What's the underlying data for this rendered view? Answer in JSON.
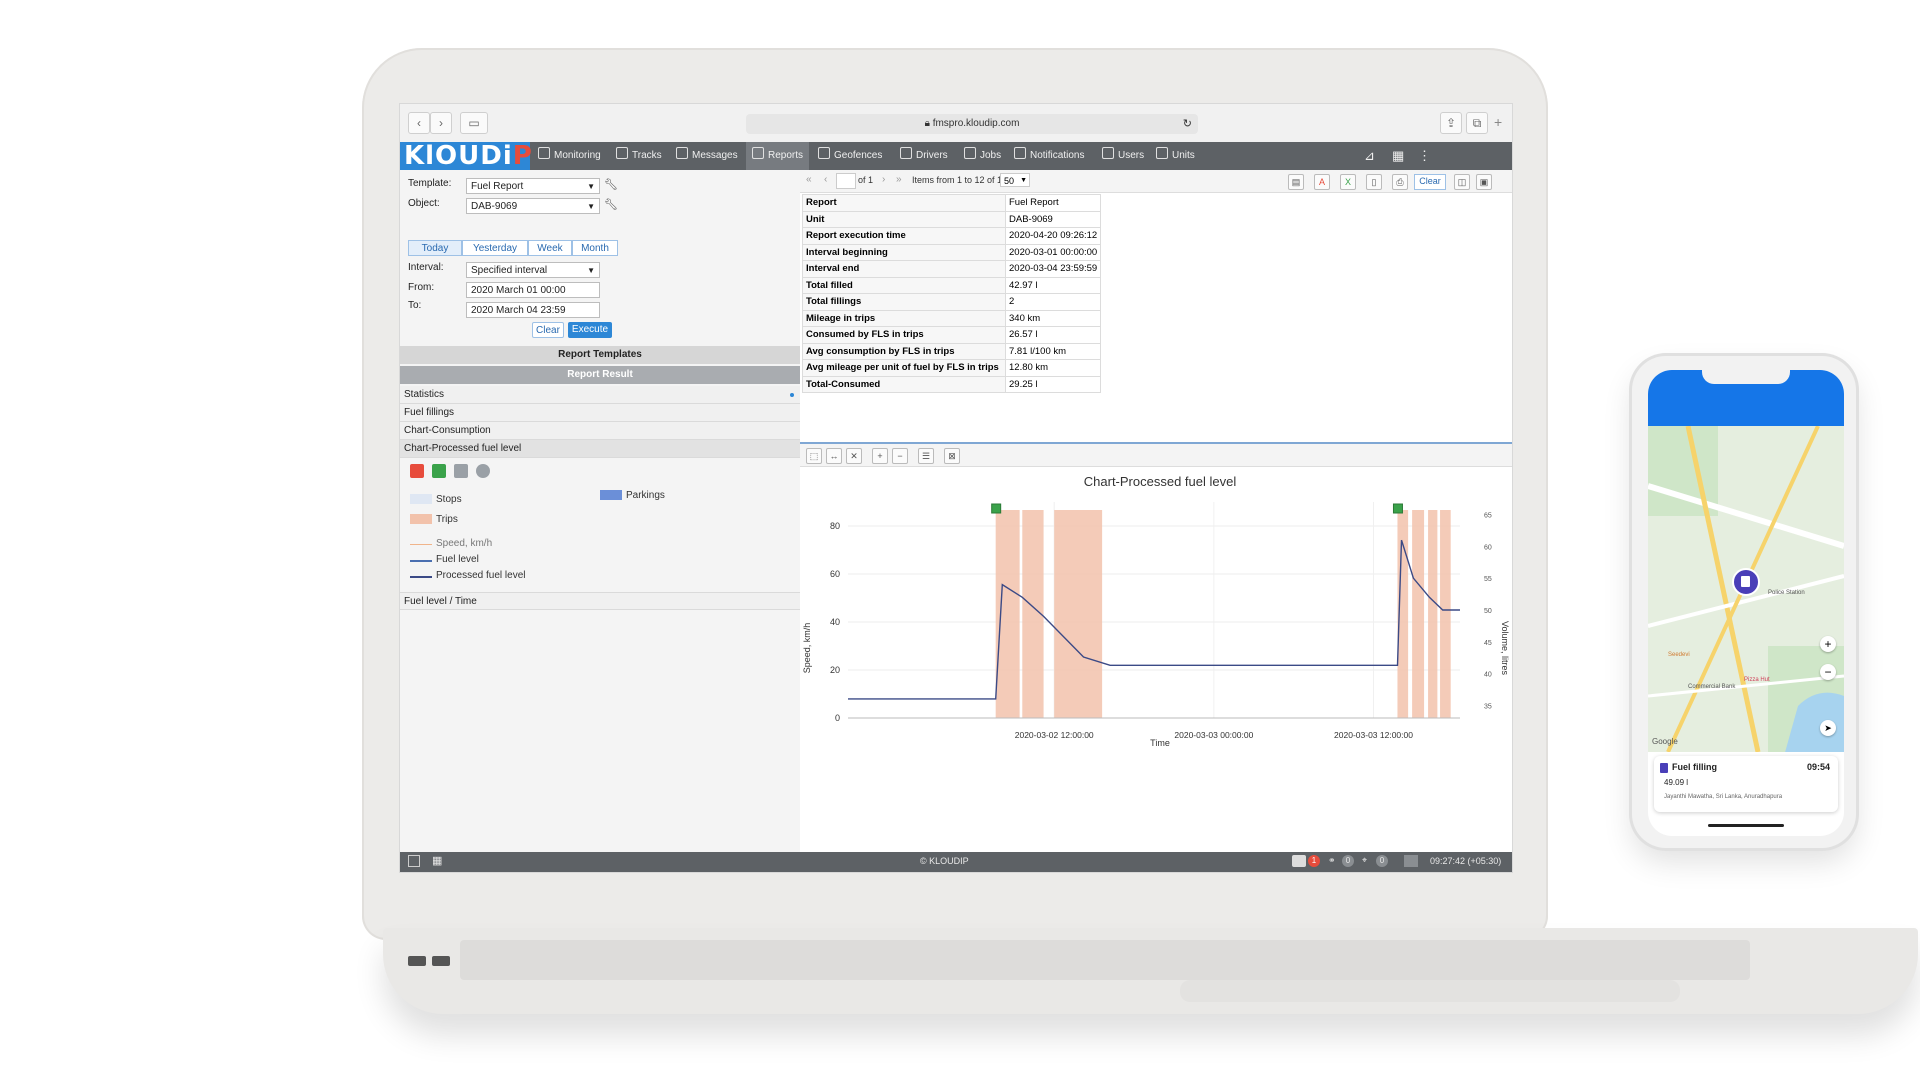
{
  "browser": {
    "url": "fmspro.kloudip.com"
  },
  "logo": {
    "text_main": "KlOUDi",
    "text_accent": "P"
  },
  "nav": {
    "items": [
      {
        "label": "Monitoring"
      },
      {
        "label": "Tracks"
      },
      {
        "label": "Messages"
      },
      {
        "label": "Reports"
      },
      {
        "label": "Geofences"
      },
      {
        "label": "Drivers"
      },
      {
        "label": "Jobs"
      },
      {
        "label": "Notifications"
      },
      {
        "label": "Users"
      },
      {
        "label": "Units"
      }
    ],
    "active": "Reports"
  },
  "form": {
    "template_label": "Template:",
    "template_value": "Fuel Report",
    "object_label": "Object:",
    "object_value": "DAB-9069",
    "periods": [
      "Today",
      "Yesterday",
      "Week",
      "Month"
    ],
    "interval_label": "Interval:",
    "interval_value": "Specified interval",
    "from_label": "From:",
    "from_value": "2020 March 01 00:00",
    "to_label": "To:",
    "to_value": "2020 March 04 23:59",
    "clear_label": "Clear",
    "execute_label": "Execute"
  },
  "sections": {
    "templates": "Report Templates",
    "result": "Report Result"
  },
  "result_items": [
    "Statistics",
    "Fuel fillings",
    "Chart-Consumption",
    "Chart-Processed fuel level"
  ],
  "legend": {
    "stops": "Stops",
    "parkings": "Parkings",
    "trips": "Trips",
    "speed": "Speed, km/h",
    "fuel_level": "Fuel level",
    "processed_fuel_level": "Processed fuel level"
  },
  "fuel_time_item": "Fuel level / Time",
  "report_toolbar": {
    "page_of": "of 1",
    "items_info": "Items from 1 to 12 of 12",
    "page_size": "50",
    "clear_label": "Clear"
  },
  "stats": [
    {
      "k": "Report",
      "v": "Fuel Report"
    },
    {
      "k": "Unit",
      "v": "DAB-9069"
    },
    {
      "k": "Report execution time",
      "v": "2020-04-20 09:26:12"
    },
    {
      "k": "Interval beginning",
      "v": "2020-03-01 00:00:00"
    },
    {
      "k": "Interval end",
      "v": "2020-03-04 23:59:59"
    },
    {
      "k": "Total filled",
      "v": "42.97 l"
    },
    {
      "k": "Total fillings",
      "v": "2"
    },
    {
      "k": "Mileage in trips",
      "v": "340 km"
    },
    {
      "k": "Consumed by FLS in trips",
      "v": "26.57 l"
    },
    {
      "k": "Avg consumption by FLS in trips",
      "v": "7.81 l/100 km"
    },
    {
      "k": "Avg mileage per unit of fuel by FLS in trips",
      "v": "12.80 km"
    },
    {
      "k": "Total-Consumed",
      "v": "29.25 l"
    }
  ],
  "chart_data": {
    "type": "line",
    "title": "Chart-Processed fuel level",
    "xlabel": "Time",
    "ylabel": "Speed, km/h",
    "y2label": "Volume, litres",
    "x_ticks": [
      "2020-03-02 12:00:00",
      "2020-03-03 00:00:00",
      "2020-03-03 12:00:00"
    ],
    "x_range_hours": [
      -15.5,
      30.5
    ],
    "ylim": [
      0,
      90
    ],
    "y_ticks": [
      0,
      20,
      40,
      60,
      80
    ],
    "y2lim": [
      33,
      67
    ],
    "y2_ticks": [
      35,
      40,
      45,
      50,
      55,
      60,
      65
    ],
    "grid": true,
    "series": [
      {
        "name": "Processed fuel level",
        "x": [
          -15.5,
          -4.4,
          -3.9,
          -2.4,
          -0.8,
          2.2,
          4.2,
          10,
          25.8,
          26.1,
          27,
          28.2,
          29.2,
          30.5
        ],
        "values": [
          36,
          36,
          54,
          52,
          49,
          42.6,
          41.3,
          41.3,
          41.3,
          61,
          55,
          52,
          50,
          50
        ]
      }
    ],
    "fillings_at_hours": [
      -4.4,
      25.8
    ],
    "trip_bands_hours": [
      [
        -4.4,
        -2.6
      ],
      [
        -2.4,
        -0.8
      ],
      [
        0.0,
        3.6
      ],
      [
        25.8,
        26.6
      ],
      [
        26.9,
        27.8
      ],
      [
        28.1,
        28.8
      ],
      [
        29.0,
        29.8
      ]
    ]
  },
  "status": {
    "copyright": "© KLOUDIP",
    "time": "09:27:42 (+05:30)",
    "badge_count": "1",
    "count_2": "0",
    "count_3": "0"
  },
  "phone": {
    "card_title": "Fuel filling",
    "card_time": "09:54",
    "card_value": "49.09 l",
    "card_address": "Jayanthi Mawatha, Sri Lanka, Anuradhapura",
    "map_brand": "Google",
    "map_labels": [
      "Pizza Hut",
      "Seedevi",
      "Commercial Bank",
      "Police Station"
    ]
  },
  "colors": {
    "nav_bg": "#5d6165",
    "logo_bg": "#2d87d6",
    "trip_band": "#f2c2ab",
    "processed_line": "#3b4a86",
    "filling_marker": "#3aa24a",
    "execute_bg": "#2d87d6",
    "phone_header": "#1576e8"
  }
}
